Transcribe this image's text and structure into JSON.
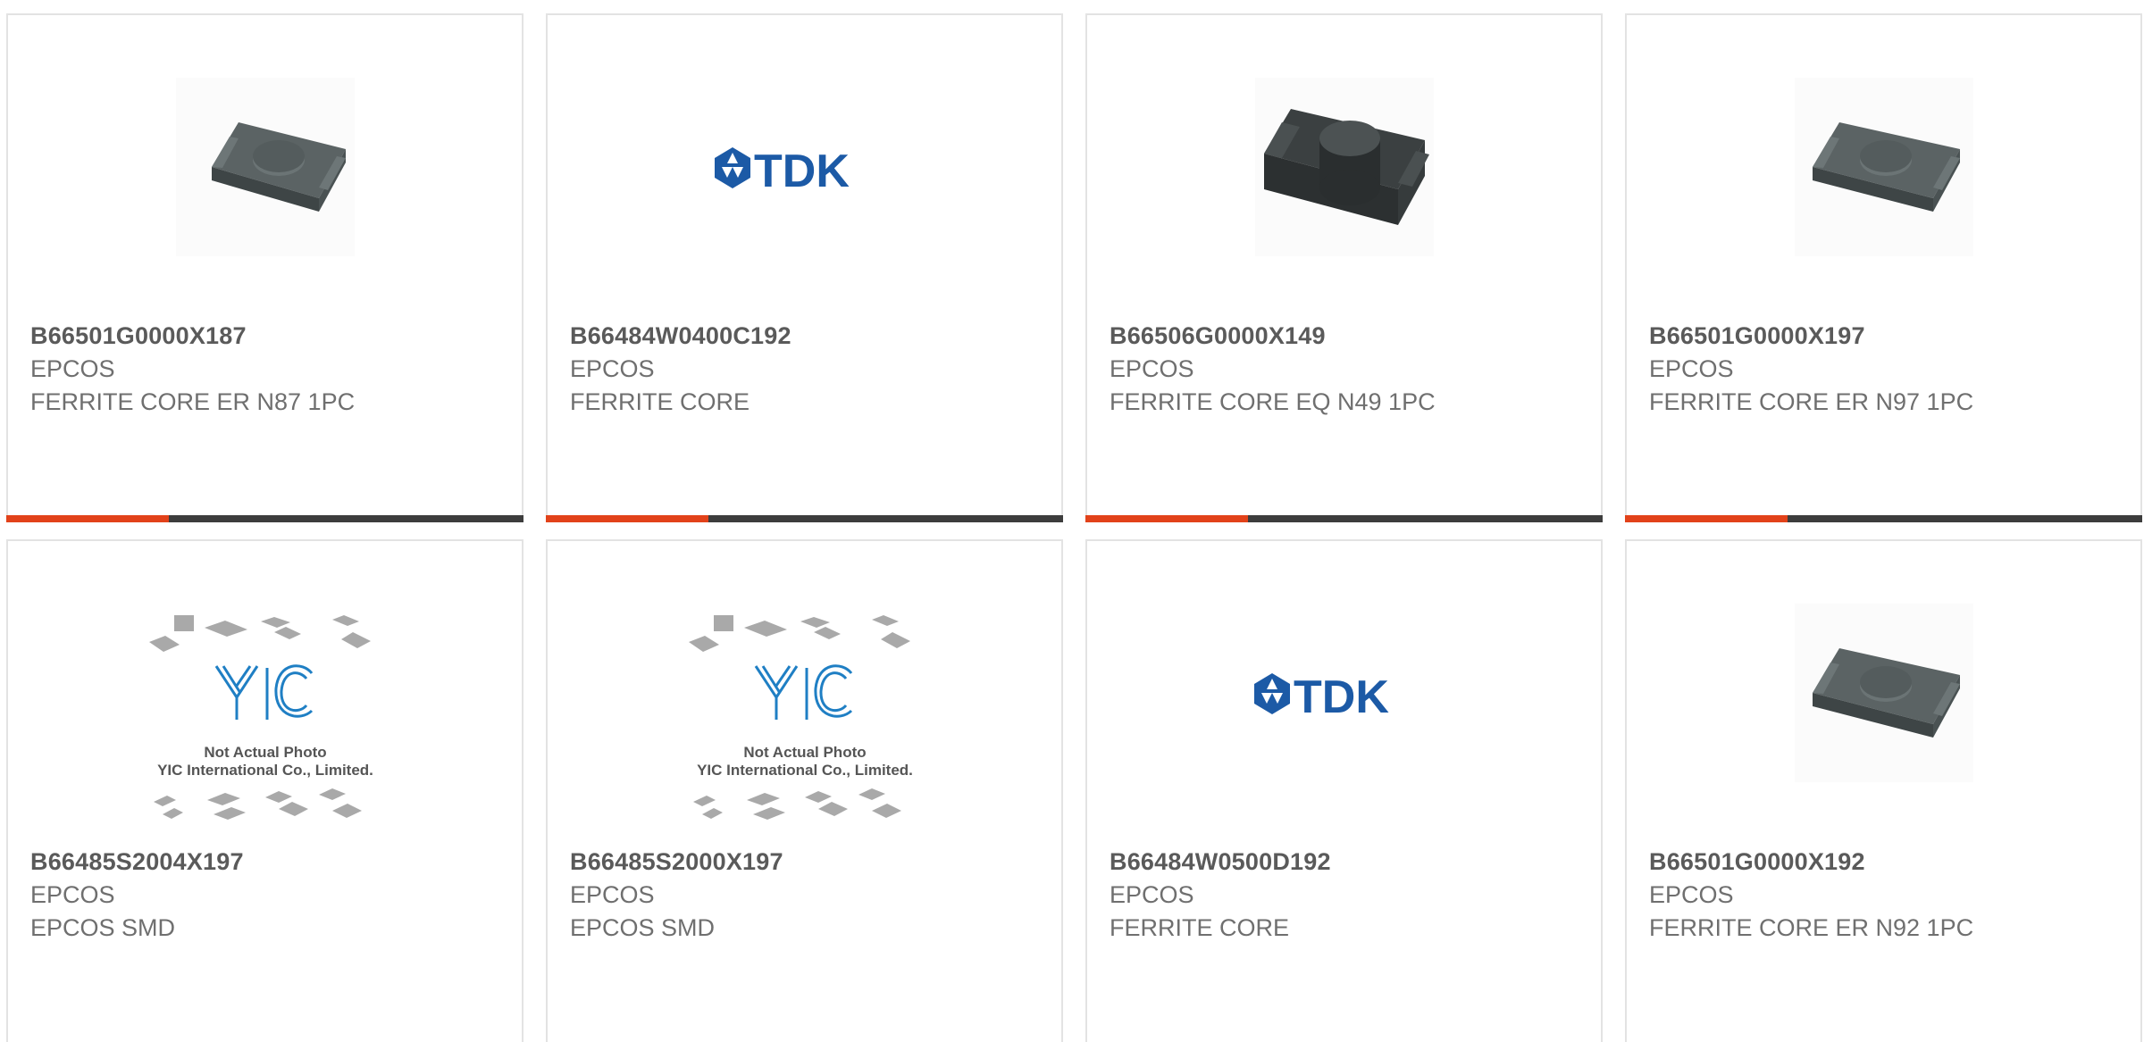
{
  "colors": {
    "accent": "#e2421a",
    "bar_track": "#3d3d3d",
    "tdk_blue": "#1c5aa6",
    "yic_blue": "#1f7fc4",
    "card_border": "#e3e3e3"
  },
  "products": [
    {
      "part_number": "B66501G0000X187",
      "manufacturer": "EPCOS",
      "description": "FERRITE CORE ER N87 1PC",
      "image": "ferrite-core-er-image"
    },
    {
      "part_number": "B66484W0400C192",
      "manufacturer": "EPCOS",
      "description": "FERRITE CORE",
      "image": "tdk-logo",
      "image_text": "TDK"
    },
    {
      "part_number": "B66506G0000X149",
      "manufacturer": "EPCOS",
      "description": "FERRITE CORE EQ N49 1PC",
      "image": "ferrite-core-eq-image"
    },
    {
      "part_number": "B66501G0000X197",
      "manufacturer": "EPCOS",
      "description": "FERRITE CORE ER N97 1PC",
      "image": "ferrite-core-er-image"
    },
    {
      "part_number": "B66485S2004X197",
      "manufacturer": "EPCOS",
      "description": "EPCOS SMD",
      "image": "yic-placeholder-image",
      "image_caption_1": "Not Actual Photo",
      "image_caption_2": "YIC International Co., Limited."
    },
    {
      "part_number": "B66485S2000X197",
      "manufacturer": "EPCOS",
      "description": "EPCOS SMD",
      "image": "yic-placeholder-image",
      "image_caption_1": "Not Actual Photo",
      "image_caption_2": "YIC International Co., Limited."
    },
    {
      "part_number": "B66484W0500D192",
      "manufacturer": "EPCOS",
      "description": "FERRITE CORE",
      "image": "tdk-logo",
      "image_text": "TDK"
    },
    {
      "part_number": "B66501G0000X192",
      "manufacturer": "EPCOS",
      "description": "FERRITE CORE ER N92 1PC",
      "image": "ferrite-core-er-image"
    }
  ]
}
